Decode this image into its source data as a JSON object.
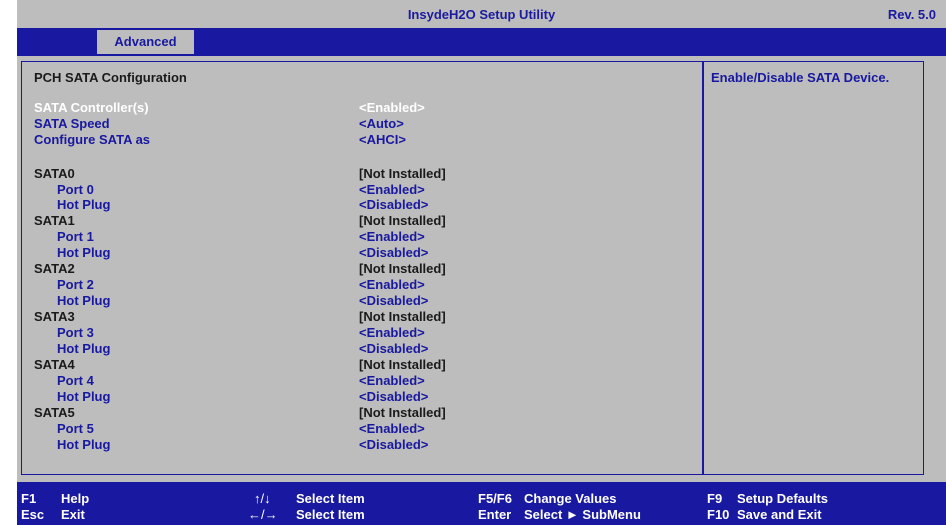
{
  "header": {
    "title": "InsydeH2O Setup Utility",
    "revision": "Rev. 5.0"
  },
  "menu": {
    "tabs": [
      {
        "label": "Advanced",
        "active": true
      }
    ]
  },
  "main": {
    "section_title": "PCH SATA Configuration",
    "help_text": "Enable/Disable SATA Device.",
    "settings": [
      {
        "label": "SATA Controller(s)",
        "value": "<Enabled>"
      },
      {
        "label": "SATA Speed",
        "value": "<Auto>"
      },
      {
        "label": "Configure SATA as",
        "value": "<AHCI>"
      }
    ],
    "sata_ports": [
      {
        "name": "SATA0",
        "status": "[Not Installed]",
        "port_label": "Port 0",
        "port_value": "<Enabled>",
        "hotplug_label": "Hot Plug",
        "hotplug_value": "<Disabled>"
      },
      {
        "name": "SATA1",
        "status": "[Not Installed]",
        "port_label": "Port 1",
        "port_value": "<Enabled>",
        "hotplug_label": "Hot Plug",
        "hotplug_value": "<Disabled>"
      },
      {
        "name": "SATA2",
        "status": "[Not Installed]",
        "port_label": "Port 2",
        "port_value": "<Enabled>",
        "hotplug_label": "Hot Plug",
        "hotplug_value": "<Disabled>"
      },
      {
        "name": "SATA3",
        "status": "[Not Installed]",
        "port_label": "Port 3",
        "port_value": "<Enabled>",
        "hotplug_label": "Hot Plug",
        "hotplug_value": "<Disabled>"
      },
      {
        "name": "SATA4",
        "status": "[Not Installed]",
        "port_label": "Port 4",
        "port_value": "<Enabled>",
        "hotplug_label": "Hot Plug",
        "hotplug_value": "<Disabled>"
      },
      {
        "name": "SATA5",
        "status": "[Not Installed]",
        "port_label": "Port 5",
        "port_value": "<Enabled>",
        "hotplug_label": "Hot Plug",
        "hotplug_value": "<Disabled>"
      }
    ]
  },
  "footer": {
    "keys": [
      {
        "key": "F1",
        "desc": "Help"
      },
      {
        "key": "Esc",
        "desc": "Exit"
      },
      {
        "key": "↑/↓",
        "desc": "Select Item"
      },
      {
        "key": "←/→",
        "desc": "Select Item"
      },
      {
        "key": "F5/F6",
        "desc": "Change Values"
      },
      {
        "key": "Enter",
        "desc": "Select ► SubMenu"
      },
      {
        "key": "F9",
        "desc": "Setup Defaults"
      },
      {
        "key": "F10",
        "desc": "Save and Exit"
      }
    ]
  },
  "colors": {
    "title_bar": "#bdbdbd",
    "menu_bar": "#1818a0",
    "panel": "#bdbdbd",
    "highlight_text": "#ffffff",
    "option_text": "#1818a0"
  }
}
